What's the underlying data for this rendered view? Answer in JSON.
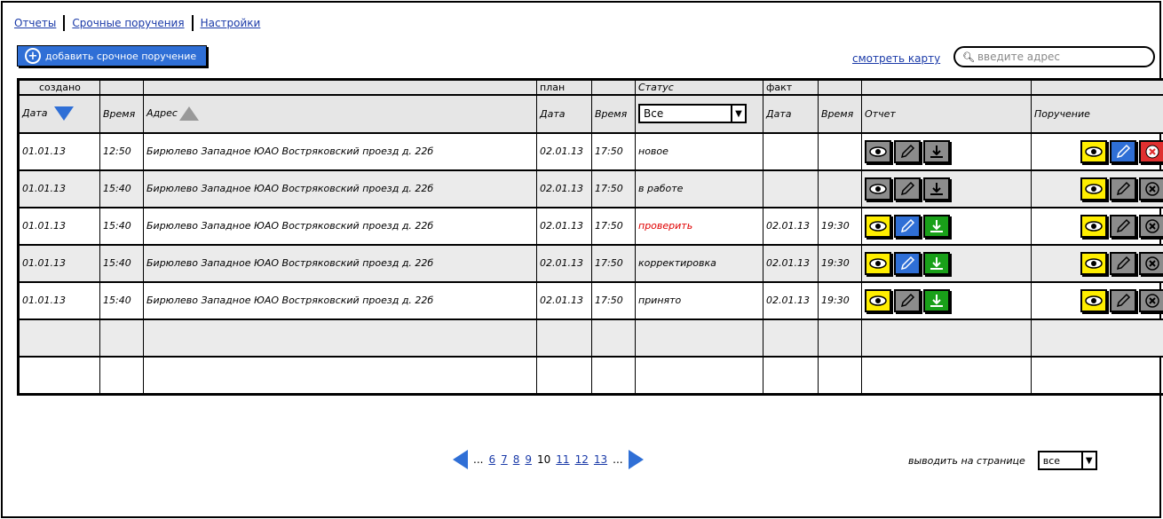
{
  "nav": {
    "reports": "Отчеты",
    "urgent": "Срочные поручения",
    "settings": "Настройки"
  },
  "add_button": {
    "label": "добавить срочное поручение",
    "icon": "plus-circle-icon"
  },
  "map_link": "смотреть карту",
  "search": {
    "placeholder": "введите адрес"
  },
  "groups": {
    "created": "создано",
    "plan": "план",
    "status": "Статус",
    "fact": "факт"
  },
  "headers": {
    "date": "Дата",
    "time": "Время",
    "address": "Адрес",
    "plan_date": "Дата",
    "plan_time": "Время",
    "status_filter": "Все",
    "fact_date": "Дата",
    "fact_time": "Время",
    "report": "Отчет",
    "order": "Поручение"
  },
  "rows": [
    {
      "date": "01.01.13",
      "time": "12:50",
      "address": "Бирюлево Западное ЮАО Востряковский проезд д. 22б",
      "plan_date": "02.01.13",
      "plan_time": "17:50",
      "status": "новое",
      "fact_date": "",
      "fact_time": ""
    },
    {
      "date": "01.01.13",
      "time": "15:40",
      "address": "Бирюлево Западное ЮАО Востряковский проезд д. 22б",
      "plan_date": "02.01.13",
      "plan_time": "17:50",
      "status": "в работе",
      "fact_date": "",
      "fact_time": ""
    },
    {
      "date": "01.01.13",
      "time": "15:40",
      "address": "Бирюлево Западное ЮАО Востряковский проезд д. 22б",
      "plan_date": "02.01.13",
      "plan_time": "17:50",
      "status": "проверить",
      "fact_date": "02.01.13",
      "fact_time": "19:30"
    },
    {
      "date": "01.01.13",
      "time": "15:40",
      "address": "Бирюлево Западное ЮАО Востряковский проезд д. 22б",
      "plan_date": "02.01.13",
      "plan_time": "17:50",
      "status": "корректировка",
      "fact_date": "02.01.13",
      "fact_time": "19:30"
    },
    {
      "date": "01.01.13",
      "time": "15:40",
      "address": "Бирюлево Западное ЮАО Востряковский проезд д. 22б",
      "plan_date": "02.01.13",
      "plan_time": "17:50",
      "status": "принято",
      "fact_date": "02.01.13",
      "fact_time": "19:30"
    }
  ],
  "colors": {
    "accent": "#2f6fd6",
    "yellow": "#ffee00",
    "gray": "#8c8c8c",
    "green": "#19a019",
    "red": "#e03030",
    "status_check": "#e00000"
  },
  "pager": {
    "ellipsis": "...",
    "pages": [
      "6",
      "7",
      "8",
      "9"
    ],
    "current": "10",
    "pages_after": [
      "11",
      "12",
      "13"
    ]
  },
  "per_page": {
    "label": "выводить на странице",
    "value": "все"
  }
}
